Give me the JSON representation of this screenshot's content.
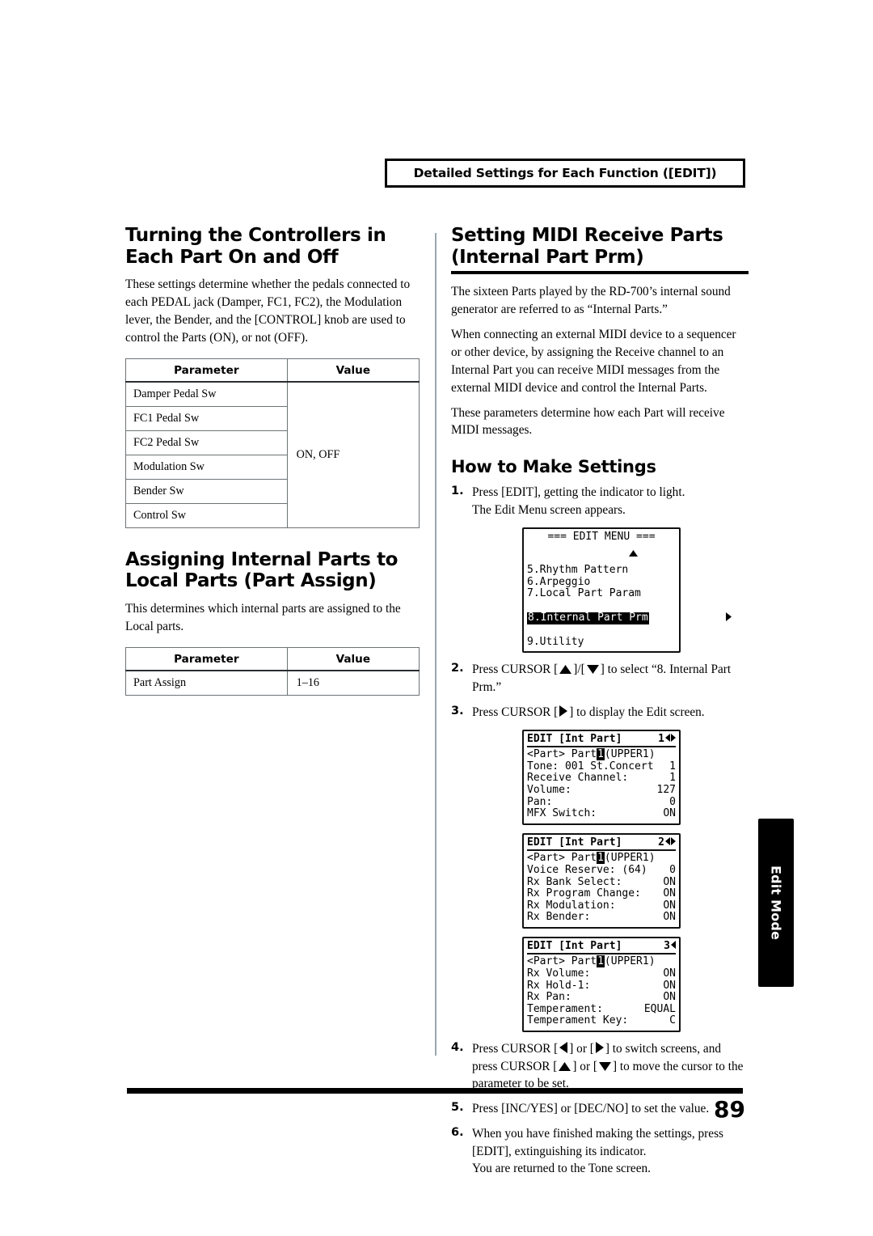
{
  "header": {
    "running_title": "Detailed Settings for Each Function ([EDIT])"
  },
  "left_column": {
    "section1": {
      "heading": "Turning the Controllers in Each Part On and Off",
      "body": "These settings determine whether the pedals connected to each PEDAL jack (Damper, FC1, FC2), the Modulation lever, the Bender, and the [CONTROL] knob are used to control the Parts (ON), or not (OFF).",
      "table": {
        "columns": [
          "Parameter",
          "Value"
        ],
        "rows": [
          {
            "parameter": "Damper Pedal Sw"
          },
          {
            "parameter": "FC1 Pedal Sw"
          },
          {
            "parameter": "FC2 Pedal Sw"
          },
          {
            "parameter": "Modulation Sw"
          },
          {
            "parameter": "Bender Sw"
          },
          {
            "parameter": "Control Sw"
          }
        ],
        "value_span": "ON, OFF"
      }
    },
    "section2": {
      "heading": "Assigning Internal Parts to Local Parts (Part Assign)",
      "body": "This determines which internal parts are assigned to the Local parts.",
      "table": {
        "columns": [
          "Parameter",
          "Value"
        ],
        "rows": [
          {
            "parameter": "Part Assign",
            "value": "1–16"
          }
        ]
      }
    }
  },
  "right_column": {
    "heading": "Setting MIDI Receive Parts (Internal Part Prm)",
    "paragraphs": [
      "The sixteen Parts played by the RD-700’s internal sound generator are referred to as “Internal Parts.”",
      "When connecting an external MIDI device to a sequencer or other device, by assigning the Receive channel to an Internal Part you can receive MIDI messages from the external MIDI device and control the Internal Parts.",
      "These parameters determine how each Part will receive MIDI messages."
    ],
    "subheading": "How to Make Settings",
    "steps": {
      "s1": {
        "num": "1.",
        "line1": "Press [EDIT], getting the indicator to light.",
        "line2": "The Edit Menu screen appears."
      },
      "s2": {
        "num": "2.",
        "part_a": "Press CURSOR [",
        "part_b": "]/[",
        "part_c": "] to select “8. Internal Part Prm.”"
      },
      "s3": {
        "num": "3.",
        "part_a": "Press CURSOR [",
        "part_b": "] to display the Edit screen."
      },
      "s4": {
        "num": "4.",
        "part_a": "Press CURSOR [",
        "part_b": "] or [",
        "part_c": "] to switch screens, and press CURSOR [",
        "part_d": "] or [",
        "part_e": "] to move the cursor to the parameter to be set."
      },
      "s5": {
        "num": "5.",
        "line1": "Press [INC/YES] or [DEC/NO] to set the value."
      },
      "s6": {
        "num": "6.",
        "line1": "When you have finished making the settings, press [EDIT], extinguishing its indicator.",
        "line2": "You are returned to the Tone screen."
      }
    },
    "lcd_edit_menu": {
      "title": "=== EDIT MENU ===",
      "items": [
        "5.Rhythm Pattern",
        "6.Arpeggio",
        "7.Local Part Param",
        "8.Internal Part Prm",
        "9.Utility"
      ],
      "selected_index": 3,
      "up_arrow": "up-triangle",
      "right_arrow": "right-triangle"
    },
    "lcd_screens": [
      {
        "title": "EDIT [Int Part]",
        "page": "1",
        "nav": "left-right",
        "part_line": {
          "prefix": "<Part> Part",
          "highlight": "1",
          "suffix": "(UPPER1)"
        },
        "rows": [
          {
            "label": "Tone: 001 St.Concert",
            "value": "1"
          },
          {
            "label": "Receive Channel:",
            "value": "1"
          },
          {
            "label": "Volume:",
            "value": "127"
          },
          {
            "label": "Pan:",
            "value": "0"
          },
          {
            "label": "MFX Switch:",
            "value": "ON"
          }
        ]
      },
      {
        "title": "EDIT [Int Part]",
        "page": "2",
        "nav": "left-right",
        "part_line": {
          "prefix": "<Part> Part",
          "highlight": "1",
          "suffix": "(UPPER1)"
        },
        "rows": [
          {
            "label": "Voice Reserve: (64)",
            "value": "0"
          },
          {
            "label": "Rx Bank Select:",
            "value": "ON"
          },
          {
            "label": "Rx Program Change:",
            "value": "ON"
          },
          {
            "label": "Rx Modulation:",
            "value": "ON"
          },
          {
            "label": "Rx Bender:",
            "value": "ON"
          }
        ]
      },
      {
        "title": "EDIT [Int Part]",
        "page": "3",
        "nav": "left",
        "part_line": {
          "prefix": "<Part> Part",
          "highlight": "1",
          "suffix": "(UPPER1)"
        },
        "rows": [
          {
            "label": "Rx Volume:",
            "value": "ON"
          },
          {
            "label": "Rx Hold-1:",
            "value": "ON"
          },
          {
            "label": "Rx Pan:",
            "value": "ON"
          },
          {
            "label": "Temperament:",
            "value": "EQUAL"
          },
          {
            "label": "Temperament Key:",
            "value": "C"
          }
        ]
      }
    ]
  },
  "side_tab": {
    "label": "Edit Mode"
  },
  "footer": {
    "page_number": "89"
  }
}
